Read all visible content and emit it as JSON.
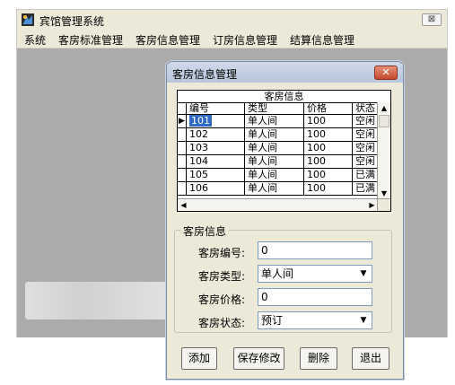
{
  "app": {
    "title": "宾馆管理系统",
    "close_symbol": "⊠",
    "menu": [
      "系统",
      "客房标准管理",
      "客房信息管理",
      "订房信息管理",
      "结算信息管理"
    ]
  },
  "dialog": {
    "title": "客房信息管理",
    "close_symbol": "✕",
    "grid": {
      "caption": "客房信息",
      "columns": [
        "编号",
        "类型",
        "价格",
        "状态"
      ],
      "rows": [
        {
          "id": "101",
          "type": "单人间",
          "price": "100",
          "status": "空闲",
          "current": true
        },
        {
          "id": "102",
          "type": "单人间",
          "price": "100",
          "status": "空闲",
          "current": false
        },
        {
          "id": "103",
          "type": "单人间",
          "price": "100",
          "status": "空闲",
          "current": false
        },
        {
          "id": "104",
          "type": "单人间",
          "price": "100",
          "status": "空闲",
          "current": false
        },
        {
          "id": "105",
          "type": "单人间",
          "price": "100",
          "status": "已满",
          "current": false
        },
        {
          "id": "106",
          "type": "单人间",
          "price": "100",
          "status": "已满",
          "current": false
        }
      ],
      "row_pointer": "▶",
      "scroll_up": "▲",
      "scroll_down": "▼",
      "scroll_left": "◀",
      "scroll_right": "▶"
    },
    "group": {
      "title": "客房信息",
      "number_label": "客房编号:",
      "number_value": "0",
      "type_label": "客房类型:",
      "type_value": "单人间",
      "price_label": "客房价格:",
      "price_value": "0",
      "status_label": "客房状态:",
      "status_value": "预订",
      "dropdown_arrow": "▼"
    },
    "buttons": {
      "add": "添加",
      "save": "保存修改",
      "delete": "删除",
      "exit": "退出"
    }
  },
  "colors": {
    "selection": "#316ac5",
    "dialog_title": "#b7c6dc",
    "close_button": "#c44a2c"
  }
}
